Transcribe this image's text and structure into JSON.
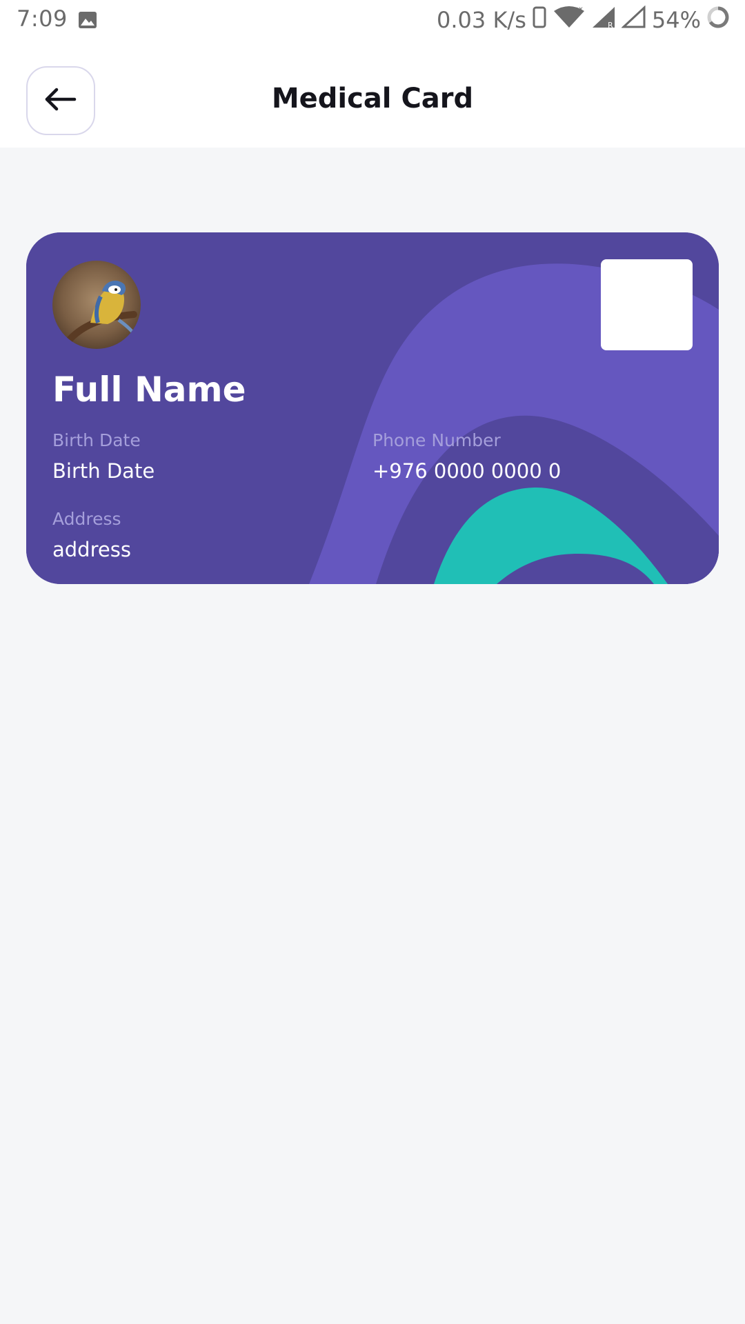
{
  "status_bar": {
    "time": "7:09",
    "network_speed": "0.03 K/s",
    "battery_percent": "54%",
    "icons": [
      "image-icon",
      "phone-icon",
      "wifi-icon",
      "signal-icon",
      "signal-empty-icon",
      "battery-ring-icon"
    ]
  },
  "header": {
    "title": "Medical Card",
    "back_icon": "arrow-left-icon"
  },
  "card": {
    "full_name": "Full Name",
    "birth_date_label": "Birth Date",
    "birth_date_value": "Birth Date",
    "phone_label": "Phone Number",
    "phone_value": "+976 0000 0000 0",
    "address_label": "Address",
    "address_value": "address",
    "colors": {
      "base": "#52479d",
      "wave": "#6557bf",
      "accent": "#20bfb6"
    }
  }
}
